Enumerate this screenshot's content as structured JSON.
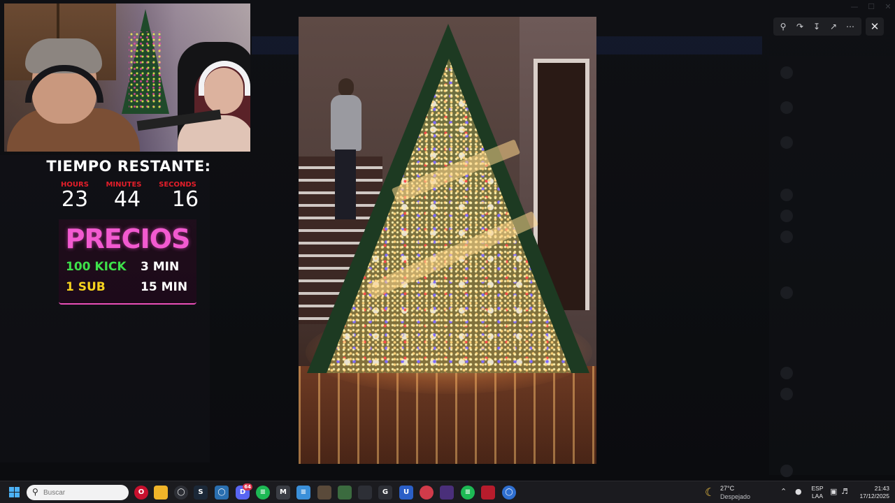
{
  "overlay": {
    "timer": {
      "title": "TIEMPO RESTANTE:",
      "hours_label": "HOURS",
      "minutes_label": "MINUTES",
      "seconds_label": "SECONDS",
      "hours": "23",
      "minutes": "44",
      "seconds": "16"
    },
    "precios": {
      "title": "PRECIOS",
      "rows": [
        {
          "item": "100 KICK",
          "time": "3 MIN",
          "item_color": "#3ee04a"
        },
        {
          "item": "1 SUB",
          "time": "15 MIN",
          "item_color": "#f5d21e"
        }
      ]
    }
  },
  "viewer": {
    "toolbar": {
      "zoom_icon": "zoom-in-icon",
      "share_icon": "share-icon",
      "download_icon": "download-icon",
      "open_icon": "open-external-icon",
      "more_icon": "more-icon",
      "close_icon": "close-icon"
    }
  },
  "taskbar": {
    "search_placeholder": "Buscar",
    "discord_badge": "64",
    "weather": {
      "temp": "27°C",
      "condition": "Despejado"
    },
    "language": {
      "line1": "ESP",
      "line2": "LAA"
    },
    "clock": {
      "time": "21:43",
      "date": "17/12/2025"
    }
  },
  "colors": {
    "accent_pink": "#f25ad0",
    "timer_label_red": "#e51e2a",
    "kick_green": "#3ee04a",
    "sub_yellow": "#f5d21e"
  }
}
